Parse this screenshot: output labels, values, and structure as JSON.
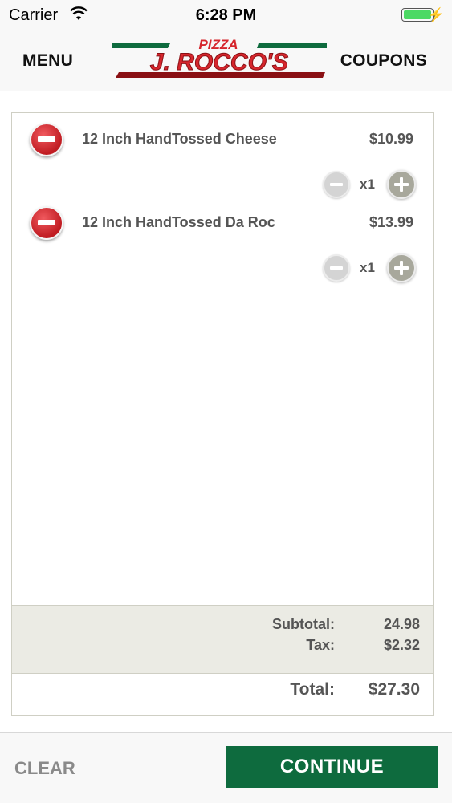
{
  "status": {
    "carrier": "Carrier",
    "time": "6:28 PM"
  },
  "nav": {
    "menu_label": "MENU",
    "coupons_label": "COUPONS",
    "logo_top": "PIZZA",
    "logo_main": "J. ROCCO'S"
  },
  "colors": {
    "brand_red": "#d6262d",
    "brand_green": "#0e6b3e",
    "summary_bg": "#ebebe4"
  },
  "cart": {
    "items": [
      {
        "name": "12 Inch HandTossed  Cheese",
        "price": "$10.99",
        "qty": "x1"
      },
      {
        "name": "12 Inch HandTossed  Da Roc",
        "price": "$13.99",
        "qty": "x1"
      }
    ],
    "subtotal_label": "Subtotal:",
    "subtotal_value": "24.98",
    "tax_label": "Tax:",
    "tax_value": "$2.32",
    "total_label": "Total:",
    "total_value": "$27.30"
  },
  "footer": {
    "clear_label": "CLEAR",
    "continue_label": "CONTINUE"
  },
  "icons": [
    "wifi-icon",
    "battery-icon",
    "charging-bolt-icon",
    "remove-item-icon",
    "decrease-qty-icon",
    "increase-qty-icon"
  ]
}
